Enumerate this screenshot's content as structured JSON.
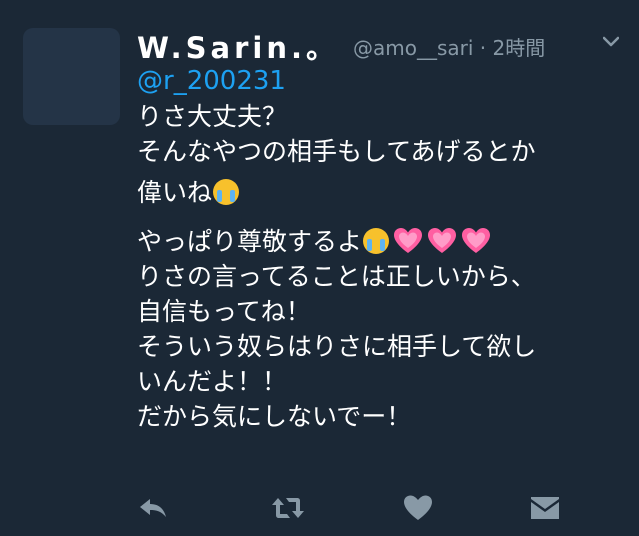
{
  "tweet": {
    "display_name": "W.Sarin.。",
    "handle_time": "@amo__sari · 2時間",
    "mention": "@r_200231",
    "lines_group1": [
      "りさ大丈夫？",
      "そんなやつの相手もしてあげるとか",
      "偉いね"
    ],
    "lines_group2": [
      "やっぱり尊敬するよ",
      "りさの言ってることは正しいから、",
      "自信もってね！",
      "そういう奴らはりさに相手して欲し",
      "いんだよ！！",
      "だから気にしないでー！"
    ]
  },
  "actions": {
    "icons": [
      "reply-icon",
      "retweet-icon",
      "like-icon",
      "message-icon"
    ]
  },
  "colors": {
    "background": "#1b2836",
    "accent": "#1da1f2",
    "muted": "#8899a6",
    "heart": "#e0245e"
  }
}
